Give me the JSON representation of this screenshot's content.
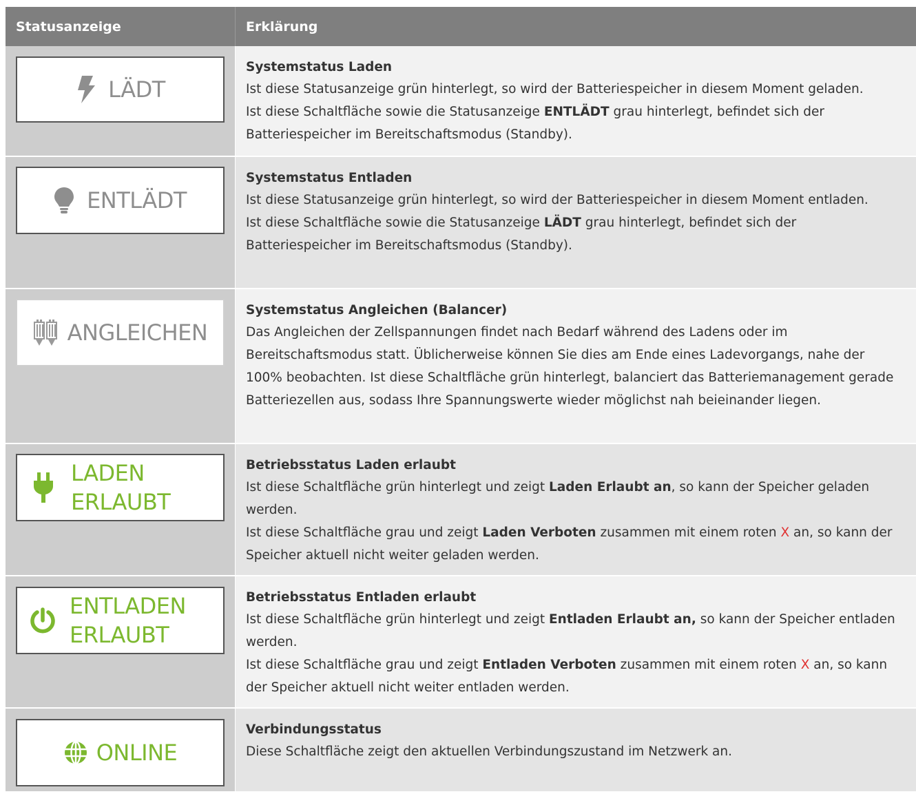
{
  "header": {
    "col1": "Statusanzeige",
    "col2": "Erklärung"
  },
  "rows": [
    {
      "button": {
        "label": "LÄDT",
        "icon": "lightning-icon",
        "color": "#8e8e8e"
      },
      "title": "Systemstatus Laden",
      "p1": "Ist diese Statusanzeige grün hinterlegt, so wird der Batteriespeicher in diesem Moment geladen.",
      "p2a": "Ist diese Schaltfläche sowie die Statusanzeige ",
      "p2b": "ENTLÄDT",
      "p2c": " grau hinterlegt, befindet sich der Batteriespeicher im Bereitschaftsmodus (Standby)."
    },
    {
      "button": {
        "label": "ENTLÄDT",
        "icon": "lightbulb-icon",
        "color": "#8e8e8e"
      },
      "title": "Systemstatus Entladen",
      "p1": "Ist diese Statusanzeige grün hinterlegt, so wird der Batteriespeicher in diesem Moment entladen.",
      "p2a": "Ist diese Schaltfläche sowie die Statusanzeige ",
      "p2b": "LÄDT",
      "p2c": " grau hinterlegt, befindet sich der Batteriespeicher im Bereitschaftsmodus (Standby)."
    },
    {
      "button": {
        "label": "ANGLEICHEN",
        "icon": "battery-cells-icon",
        "color": "#8e8e8e"
      },
      "title": "Systemstatus Angleichen (Balancer)",
      "p1": "Das Angleichen der Zellspannungen findet nach Bedarf während des Ladens oder im Bereitschaftsmodus statt. Üblicherweise können Sie dies am Ende eines Ladevorgangs, nahe der 100% beobachten. Ist diese Schaltfläche grün hinterlegt, balanciert das Batteriemanagement gerade Batteriezellen aus, sodass Ihre Spannungswerte wieder möglichst nah beieinander liegen."
    },
    {
      "button": {
        "line1": "LADEN",
        "line2": "ERLAUBT",
        "icon": "plug-icon",
        "color": "#7cb82f"
      },
      "title": "Betriebsstatus Laden erlaubt",
      "p1a": "Ist diese Schaltfläche grün hinterlegt und zeigt ",
      "p1b": "Laden Erlaubt an",
      "p1c": ", so kann der Speicher geladen werden.",
      "p2a": "Ist diese Schaltfläche grau und zeigt ",
      "p2b": "Laden Verboten",
      "p2c": " zusammen mit einem roten ",
      "p2x": "X",
      "p2d": " an, so kann der Speicher aktuell nicht weiter geladen werden."
    },
    {
      "button": {
        "line1": "ENTLADEN",
        "line2": "ERLAUBT",
        "icon": "power-icon",
        "color": "#7cb82f"
      },
      "title": "Betriebsstatus Entladen erlaubt",
      "p1a": "Ist diese Schaltfläche grün hinterlegt und zeigt ",
      "p1b": "Entladen Erlaubt an,",
      "p1c": " so kann der Speicher entladen werden.",
      "p2a": "Ist diese Schaltfläche grau und zeigt ",
      "p2b": "Entladen Verboten",
      "p2c": " zusammen mit einem roten ",
      "p2x": "X",
      "p2d": " an, so kann der Speicher aktuell nicht weiter entladen werden."
    },
    {
      "button": {
        "label": "ONLINE",
        "icon": "globe-icon",
        "color": "#7cb82f"
      },
      "title": "Verbindungsstatus",
      "p1": "Diese Schaltfläche zeigt den aktuellen Verbindungszustand im Netzwerk an."
    }
  ]
}
